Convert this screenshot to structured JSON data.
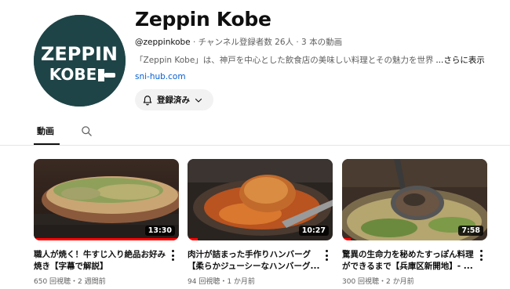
{
  "channel": {
    "title": "Zeppin Kobe",
    "handle": "@zeppinkobe",
    "stats": " · チャンネル登録者数 26人 · 3 本の動画",
    "description": "「Zeppin Kobe」は、神戸を中心とした飲食店の美味しい料理とその魅力を世界に",
    "more_label": "...さらに表示",
    "link": "sni-hub.com",
    "subscribe_label": "登録済み",
    "avatar_logo": [
      "ZEPPIN",
      "KOBE"
    ]
  },
  "tabs": {
    "videos_label": "動画"
  },
  "videos": [
    {
      "title_line1": "職人が焼く！牛すじ入り絶品お好み",
      "title_line2": "焼き【字幕で解説】",
      "meta": "650 回視聴・2 週間前",
      "duration": "13:30",
      "watched": 1.0
    },
    {
      "title_line1": "肉汁が詰まった手作りハンバーグ",
      "title_line2": "【柔らかジューシーなハンバーグ...",
      "meta": "94 回視聴・1 か月前",
      "duration": "10:27",
      "watched": 0.07
    },
    {
      "title_line1": "驚異の生命力を秘めたすっぽん料理",
      "title_line2": "ができるまで【兵庫区新開地】- ...",
      "meta": "300 回視聴・2 か月前",
      "duration": "7:58",
      "watched": 0.06
    }
  ],
  "colors": {
    "avatar_bg": "#1f4447",
    "progress": "#ff0000",
    "link": "#065fd4"
  }
}
